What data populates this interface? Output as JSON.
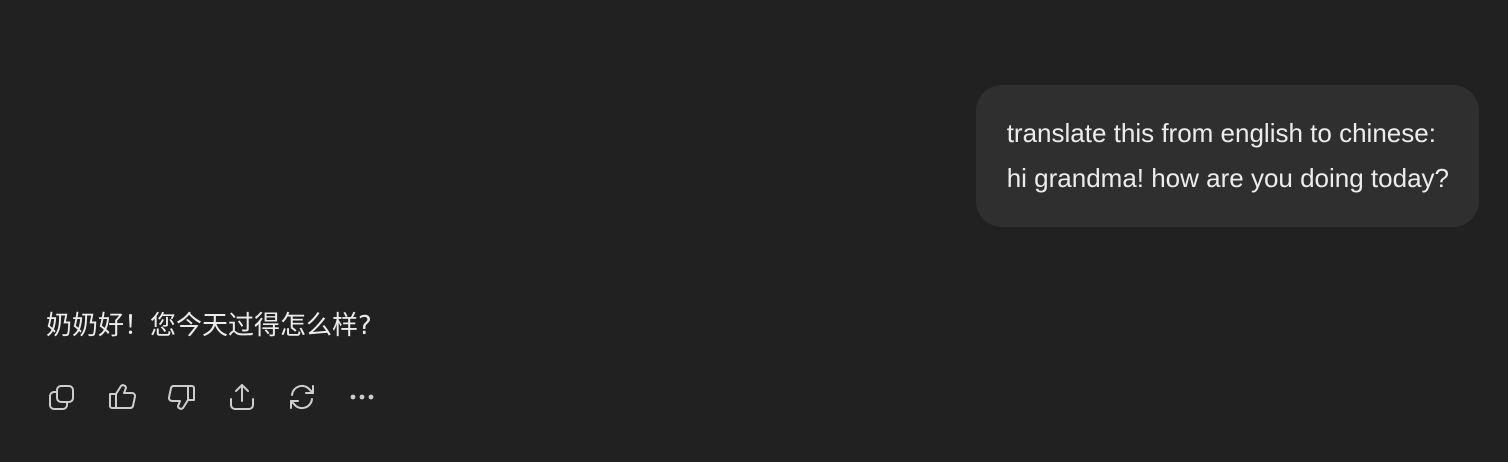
{
  "conversation": {
    "user_message": {
      "lines": [
        "translate this from english to chinese:",
        "hi grandma! how are you doing today?"
      ]
    },
    "assistant_message": {
      "text": "奶奶好！您今天过得怎么样?"
    },
    "actions": [
      {
        "name": "copy-button",
        "icon": "copy-icon"
      },
      {
        "name": "thumbs-up-button",
        "icon": "thumbs-up-icon"
      },
      {
        "name": "thumbs-down-button",
        "icon": "thumbs-down-icon"
      },
      {
        "name": "share-button",
        "icon": "share-icon"
      },
      {
        "name": "regenerate-button",
        "icon": "refresh-icon"
      },
      {
        "name": "more-options-button",
        "icon": "more-icon"
      }
    ]
  },
  "colors": {
    "background": "#212121",
    "user_bubble": "#2f2f2f",
    "text": "#ececec",
    "icon": "#cdcdcd"
  }
}
